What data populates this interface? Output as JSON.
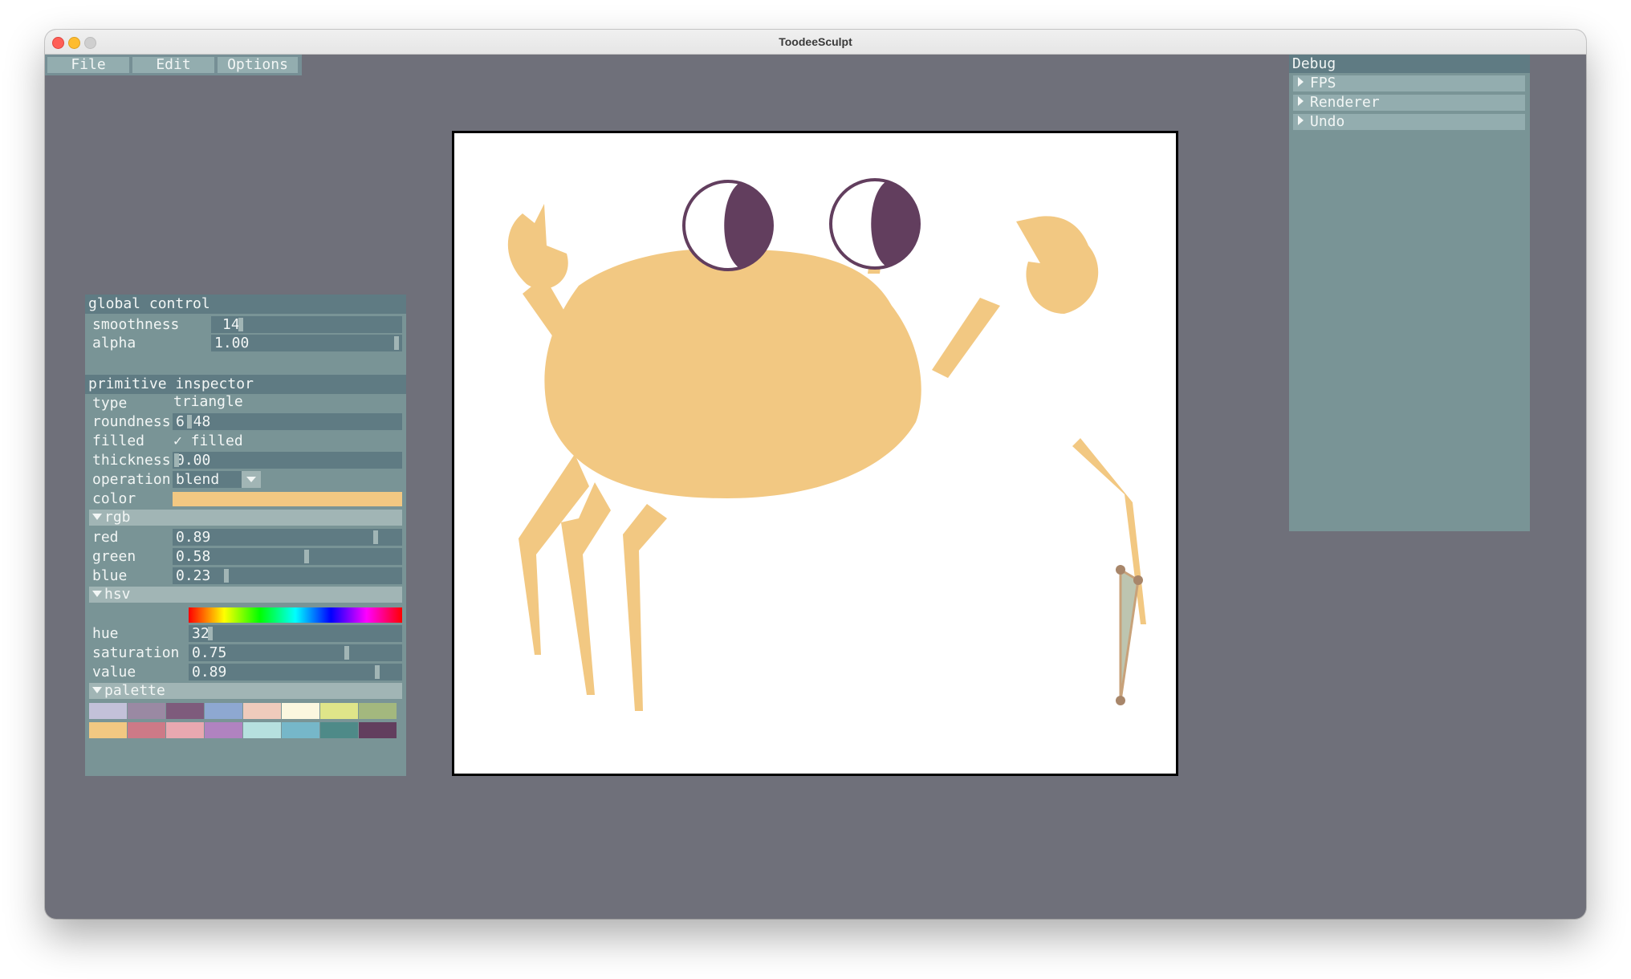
{
  "window": {
    "title": "ToodeeSculpt"
  },
  "menu": {
    "file": "File",
    "edit": "Edit",
    "options": "Options"
  },
  "global_control": {
    "header": "global control",
    "smoothness_label": "smoothness",
    "smoothness_value": "14",
    "alpha_label": "alpha",
    "alpha_value": "1.00"
  },
  "inspector": {
    "header": "primitive inspector",
    "type_label": "type",
    "type_value": "triangle",
    "roundness_label": "roundness",
    "roundness_value": "6.48",
    "filled_label": "filled",
    "filled_check": "✓",
    "filled_value": "filled",
    "thickness_label": "thickness",
    "thickness_value": "0.00",
    "operation_label": "operation",
    "operation_value": "blend",
    "color_label": "color",
    "color_hex": "#f2c882",
    "rgb_section": "rgb",
    "red_label": "red",
    "red_value": "0.89",
    "green_label": "green",
    "green_value": "0.58",
    "blue_label": "blue",
    "blue_value": "0.23",
    "hsv_section": "hsv",
    "hue_label": "hue",
    "hue_value": "32",
    "saturation_label": "saturation",
    "saturation_value": "0.75",
    "value_label": "value",
    "value_value": "0.89",
    "palette_section": "palette",
    "palette": [
      "#c3c1d9",
      "#9a89a3",
      "#7e5b7c",
      "#8ea8d1",
      "#efcbbc",
      "#fbf7df",
      "#dfe589",
      "#a3b87e",
      "#f2c882",
      "#cd7a87",
      "#e8a8b0",
      "#b083c0",
      "#b6e0df",
      "#76b7c9",
      "#4e8a88",
      "#623e5e"
    ]
  },
  "debug": {
    "header": "Debug",
    "items": [
      "FPS",
      "Renderer",
      "Undo"
    ]
  },
  "icons": {
    "dropdown": "chevron-down-icon",
    "section_open": "caret-down-icon",
    "tree_closed": "caret-right-icon",
    "check": "checkmark-icon"
  }
}
